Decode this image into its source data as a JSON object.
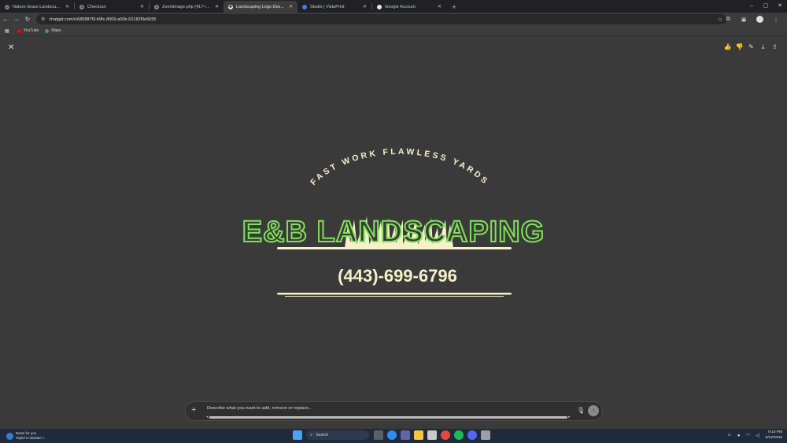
{
  "browser": {
    "tabs": [
      {
        "title": "Nature Grass Landscaping | De",
        "favicon": "d-icon",
        "active": false
      },
      {
        "title": "Checkout",
        "favicon": "checkout-icon",
        "active": false
      },
      {
        "title": "Zoomimage.php (417×471)",
        "favicon": "page-icon",
        "active": false
      },
      {
        "title": "Landscaping Logo Design",
        "favicon": "chatgpt-icon",
        "active": true
      },
      {
        "title": "Studio | VistaPrint",
        "favicon": "vistaprint-icon",
        "active": false
      },
      {
        "title": "Google Account",
        "favicon": "google-icon",
        "active": false
      }
    ],
    "new_tab": "+",
    "window_controls": {
      "minimize": "–",
      "maximize": "▢",
      "close": "✕"
    },
    "url": "chatgpt.com/c/685887f3-b9fc-8009-a00b-62182f0e5655",
    "nav": {
      "back": "←",
      "forward": "→",
      "reload": "↻"
    },
    "bookmarks": [
      {
        "label": "YouTube",
        "color": "#ff0000"
      },
      {
        "label": "Maps",
        "color": "#34a853"
      }
    ]
  },
  "viewer": {
    "close": "✕",
    "actions": [
      {
        "name": "thumbs-up-icon",
        "glyph": "👍"
      },
      {
        "name": "thumbs-down-icon",
        "glyph": "👎"
      },
      {
        "name": "edit-brush-icon",
        "glyph": "✎"
      },
      {
        "name": "download-icon",
        "glyph": "⤓"
      },
      {
        "name": "share-icon",
        "glyph": "⇪"
      }
    ]
  },
  "logo": {
    "tagline": "FAST WORK FLAWLESS YARDS",
    "brand": "E&B LANDSCAPING",
    "phone": "(443)-699-6796",
    "colors": {
      "green": "#7fe357",
      "cream": "#f6f1c8",
      "background": "#3a3a3a"
    }
  },
  "prompt": {
    "placeholder": "Describe what you want to add, remove or replace...",
    "plus": "+",
    "mic": "🎙",
    "send": "↑"
  },
  "taskbar": {
    "news_title": "News for you",
    "news_subtitle": "Taylor's robotaxi l...",
    "search_label": "Search",
    "time": "9:10 PM",
    "date": "6/22/2025"
  }
}
